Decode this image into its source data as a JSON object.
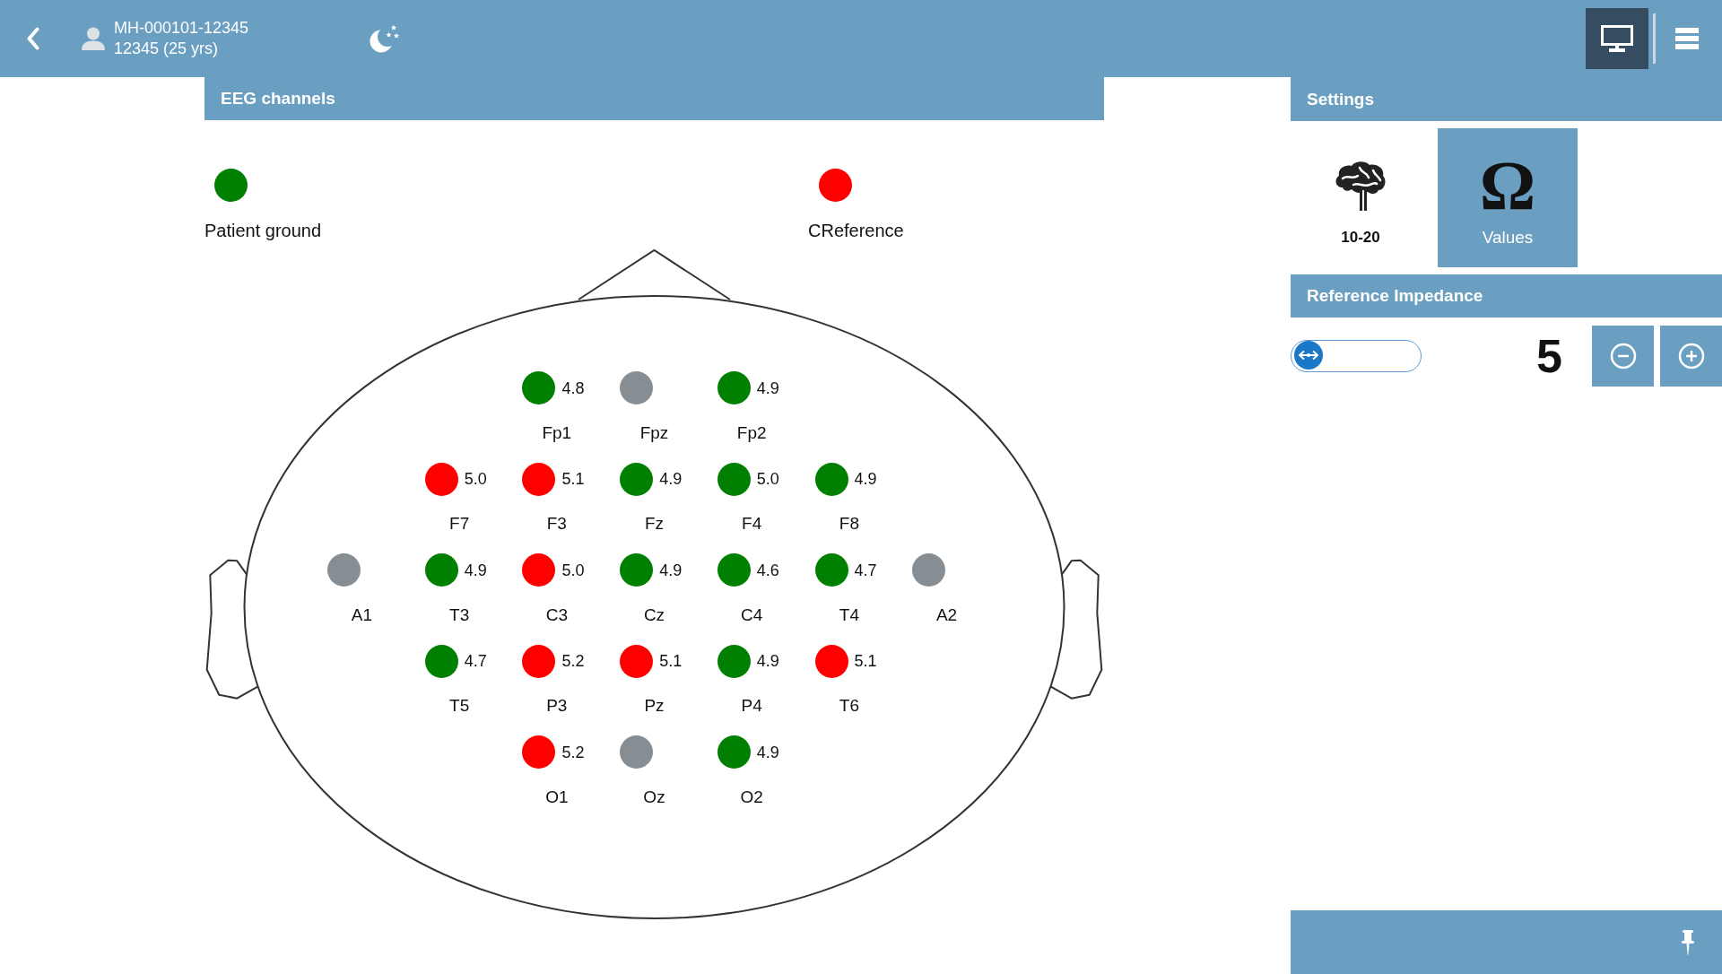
{
  "top_bar": {
    "patient_id": "MH-000101-12345",
    "patient_details": "12345 (25 yrs)",
    "display_button": {
      "selected": true
    }
  },
  "eeg_channels": {
    "title": "EEG channels",
    "legend": [
      {
        "label": "Patient ground",
        "color": "#008000"
      },
      {
        "label": "CReference",
        "color": "#ff0000"
      }
    ],
    "rows": [
      {
        "electrodes": [
          {
            "name": "Fp1",
            "value": "4.8",
            "color": "#008000"
          },
          {
            "name": "Fpz",
            "color": "#878e93"
          },
          {
            "name": "Fp2",
            "value": "4.9",
            "color": "#008000"
          }
        ]
      },
      {
        "electrodes": [
          {
            "name": "F7",
            "value": "5.0",
            "color": "#ff0000"
          },
          {
            "name": "F3",
            "value": "5.1",
            "color": "#ff0000"
          },
          {
            "name": "Fz",
            "value": "4.9",
            "color": "#008000"
          },
          {
            "name": "F4",
            "value": "5.0",
            "color": "#008000"
          },
          {
            "name": "F8",
            "value": "4.9",
            "color": "#008000"
          }
        ]
      },
      {
        "electrodes": [
          {
            "name": "A1",
            "color": "#878e93"
          },
          {
            "name": "T3",
            "value": "4.9",
            "color": "#008000"
          },
          {
            "name": "C3",
            "value": "5.0",
            "color": "#ff0000"
          },
          {
            "name": "Cz",
            "value": "4.9",
            "color": "#008000"
          },
          {
            "name": "C4",
            "value": "4.6",
            "color": "#008000"
          },
          {
            "name": "T4",
            "value": "4.7",
            "color": "#008000"
          },
          {
            "name": "A2",
            "color": "#878e93"
          }
        ]
      },
      {
        "electrodes": [
          {
            "name": "T5",
            "value": "4.7",
            "color": "#008000"
          },
          {
            "name": "P3",
            "value": "5.2",
            "color": "#ff0000"
          },
          {
            "name": "Pz",
            "value": "5.1",
            "color": "#ff0000"
          },
          {
            "name": "P4",
            "value": "4.9",
            "color": "#008000"
          },
          {
            "name": "T6",
            "value": "5.1",
            "color": "#ff0000"
          }
        ]
      },
      {
        "electrodes": [
          {
            "name": "O1",
            "value": "5.2",
            "color": "#ff0000"
          },
          {
            "name": "Oz",
            "color": "#878e93"
          },
          {
            "name": "O2",
            "value": "4.9",
            "color": "#008000"
          }
        ]
      }
    ]
  },
  "settings": {
    "title": "Settings",
    "modes": [
      {
        "kind": "brain",
        "label": "10-20",
        "selected": false
      },
      {
        "kind": "symbol",
        "symbol": "Ω",
        "label": "Values",
        "selected": true
      }
    ]
  },
  "reference_impedance": {
    "title": "Reference Impedance",
    "slider": {
      "level": 0
    },
    "value": "5"
  }
}
